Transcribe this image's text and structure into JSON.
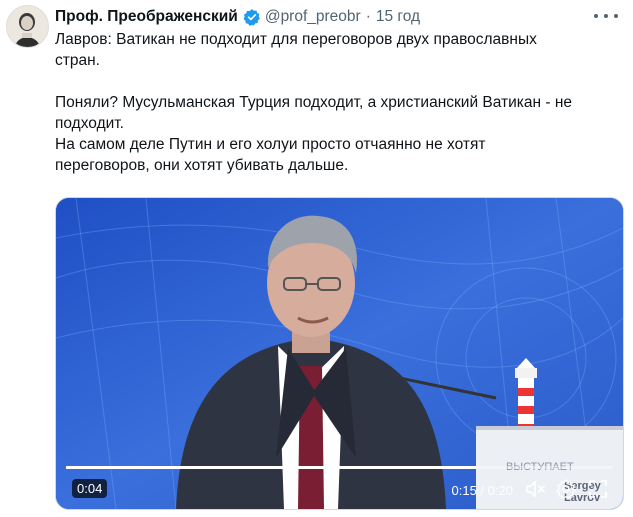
{
  "author": {
    "display_name": "Проф. Преображенский",
    "handle": "@prof_preobr",
    "separator": "·",
    "time": "15 год"
  },
  "tweet": {
    "line1": "Лавров: Ватикан не подходит для переговоров двух православных",
    "line2": "стран.",
    "line3": "Поняли? Мусульманская Турция подходит, а христианский Ватикан - не",
    "line4": "подходит.",
    "line5": "На самом деле Путин и его холуи просто отчаянно не хотят",
    "line6": "переговоров, они хотят убивать дальше."
  },
  "video": {
    "elapsed_badge": "0:04",
    "position": "0:15 / 0:20",
    "progress_fraction": 0.75,
    "nameplate": "Sergey Lavrov",
    "overlay_text": "ВЫСТУПАЕТ"
  },
  "colors": {
    "text": "#0f1419",
    "secondary": "#536471",
    "verified": "#1d9bf0",
    "stage_blue": "#2f5ec8"
  },
  "icons": [
    "verified-badge-icon",
    "more-icon",
    "volume-mute-icon",
    "settings-gear-icon",
    "fullscreen-icon"
  ]
}
